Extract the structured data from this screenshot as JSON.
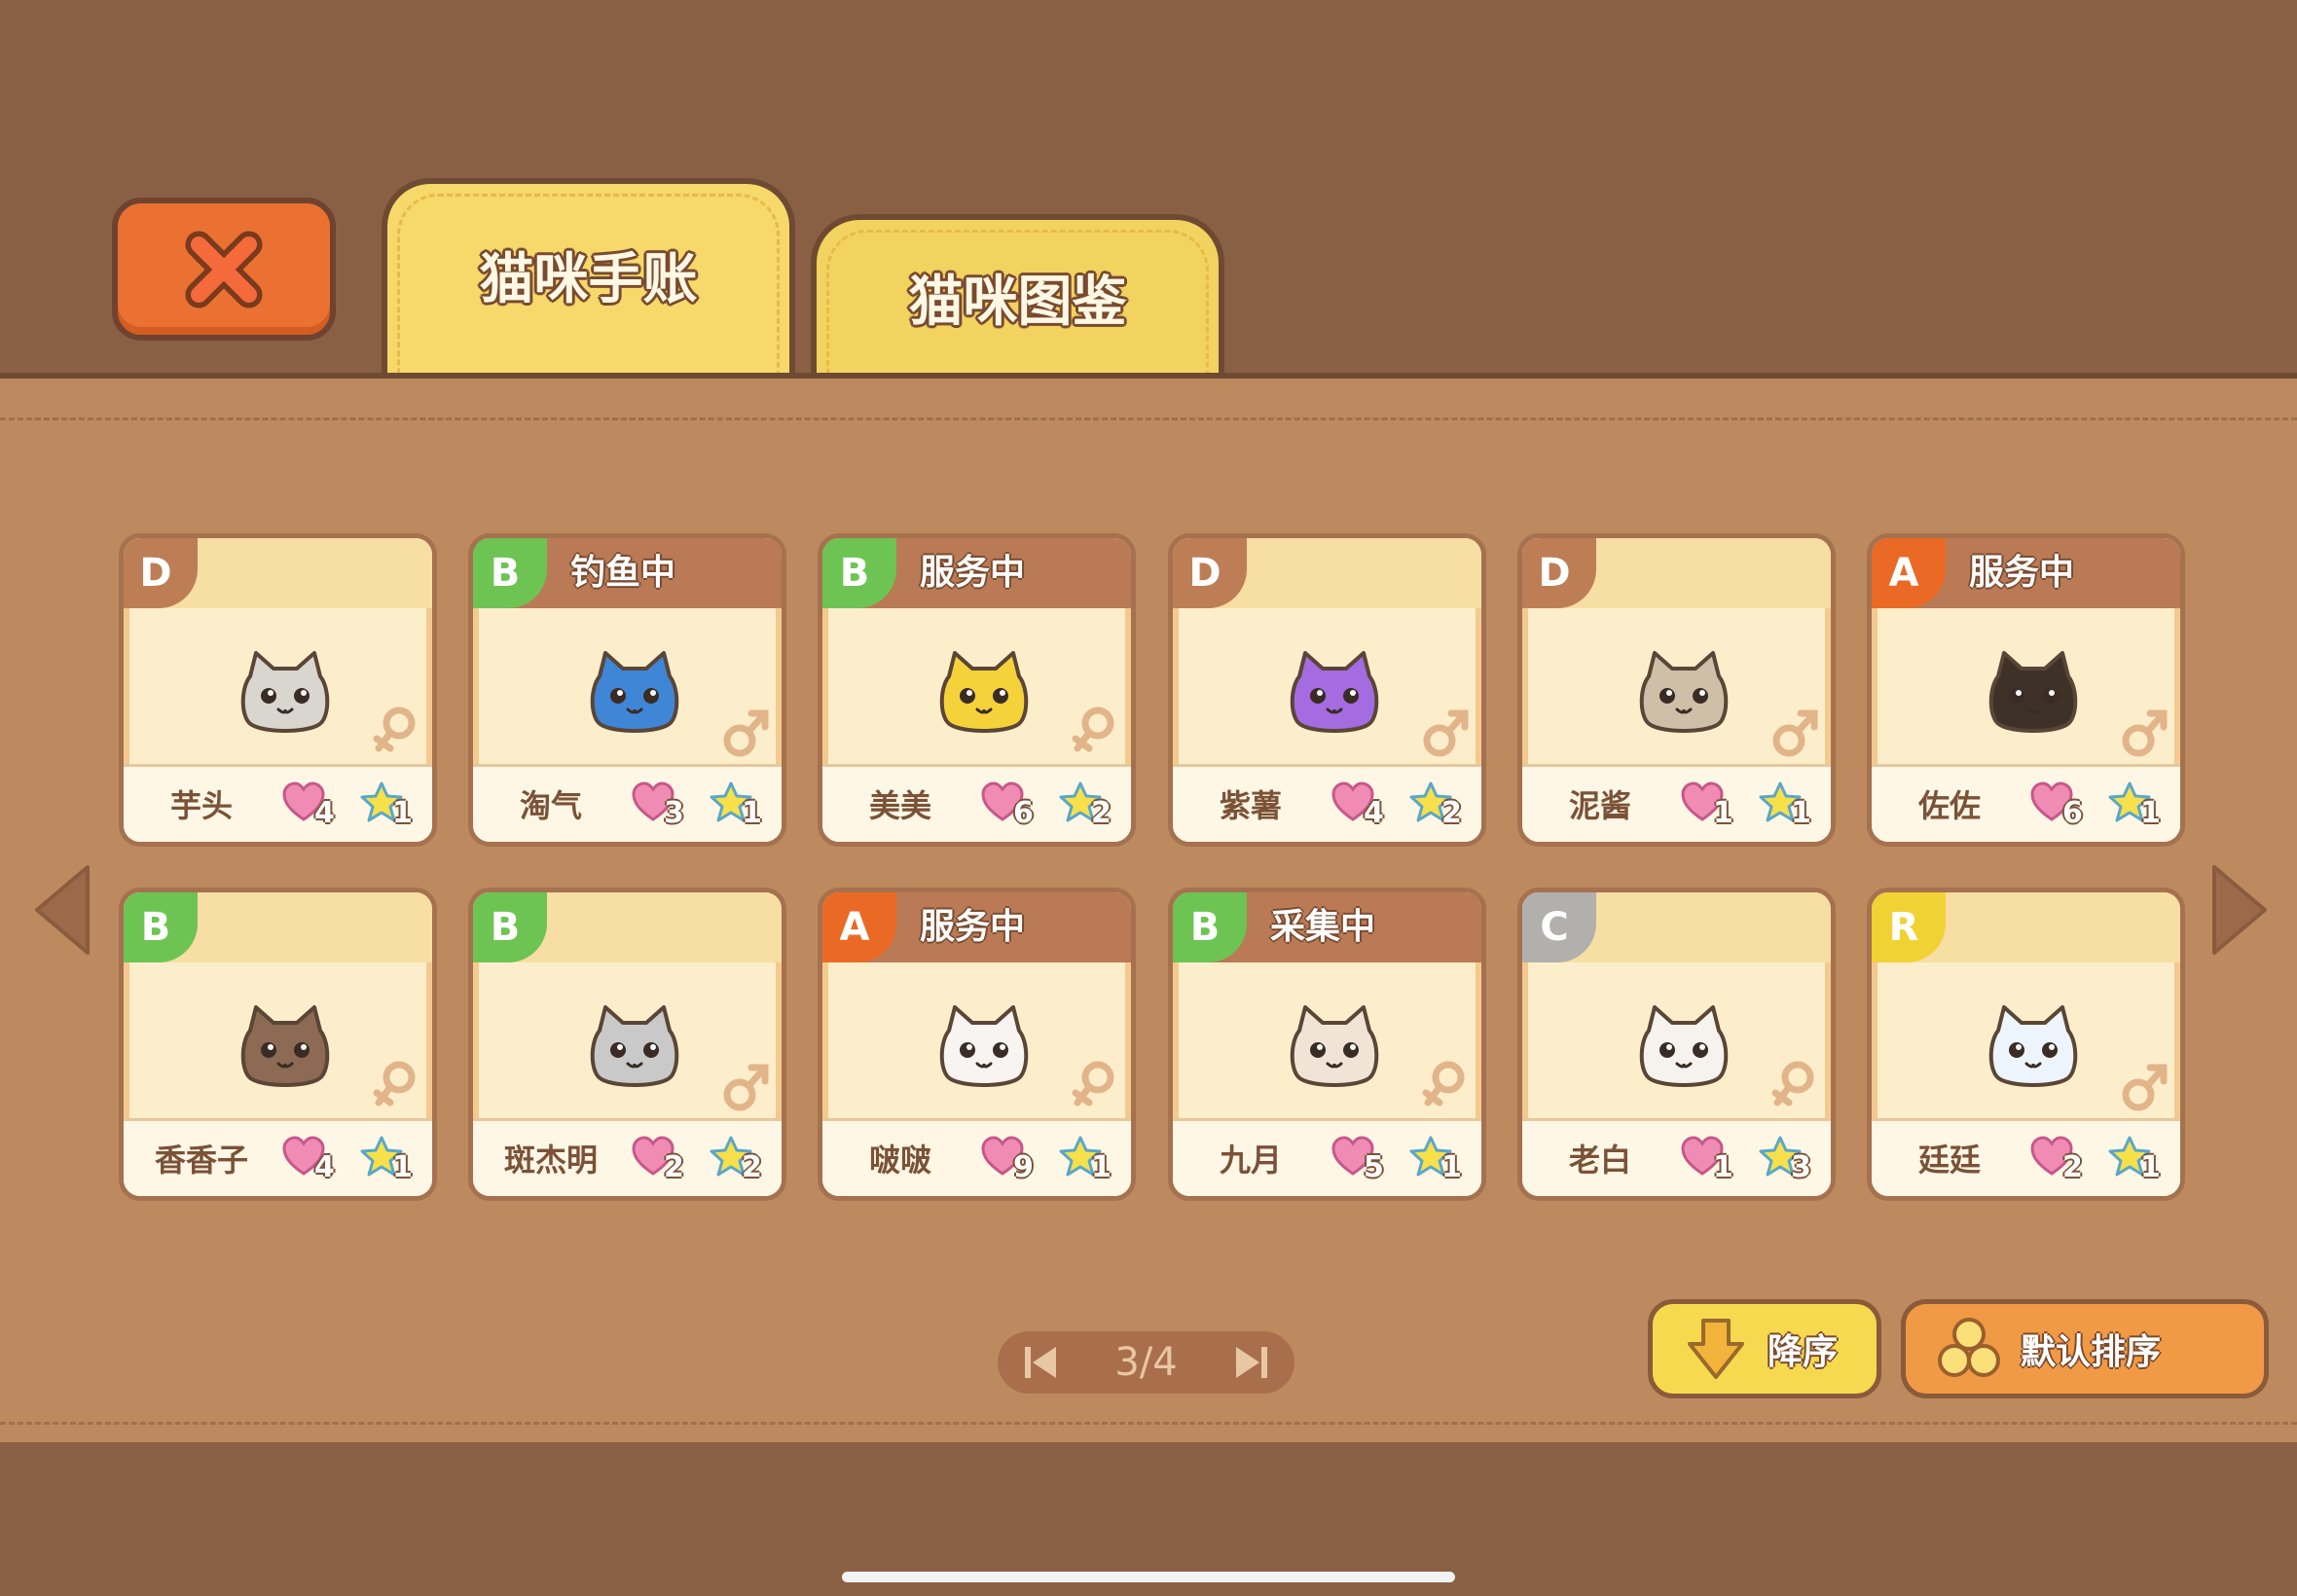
{
  "tabs": [
    {
      "label": "猫咪手账"
    },
    {
      "label": "猫咪图鉴"
    }
  ],
  "cats": [
    {
      "grade": "D",
      "status": "",
      "name": "芋头",
      "hearts": "4",
      "stars": "1",
      "gender": "female",
      "color": "#d9d5cf"
    },
    {
      "grade": "B",
      "status": "钓鱼中",
      "name": "淘气",
      "hearts": "3",
      "stars": "1",
      "gender": "male",
      "color": "#3f86d6"
    },
    {
      "grade": "B",
      "status": "服务中",
      "name": "美美",
      "hearts": "6",
      "stars": "2",
      "gender": "female",
      "color": "#f5d23a"
    },
    {
      "grade": "D",
      "status": "",
      "name": "紫薯",
      "hearts": "4",
      "stars": "2",
      "gender": "male",
      "color": "#a56be0"
    },
    {
      "grade": "D",
      "status": "",
      "name": "泥酱",
      "hearts": "1",
      "stars": "1",
      "gender": "male",
      "color": "#cdbfa8"
    },
    {
      "grade": "A",
      "status": "服务中",
      "name": "佐佐",
      "hearts": "6",
      "stars": "1",
      "gender": "male",
      "color": "#3d3128"
    },
    {
      "grade": "B",
      "status": "",
      "name": "香香子",
      "hearts": "4",
      "stars": "1",
      "gender": "female",
      "color": "#8c6a53"
    },
    {
      "grade": "B",
      "status": "",
      "name": "斑杰明",
      "hearts": "2",
      "stars": "2",
      "gender": "male",
      "color": "#c9c9c9"
    },
    {
      "grade": "A",
      "status": "服务中",
      "name": "啵啵",
      "hearts": "9",
      "stars": "1",
      "gender": "female",
      "color": "#f7f4f2"
    },
    {
      "grade": "B",
      "status": "采集中",
      "name": "九月",
      "hearts": "5",
      "stars": "1",
      "gender": "female",
      "color": "#f1e4d6"
    },
    {
      "grade": "C",
      "status": "",
      "name": "老白",
      "hearts": "1",
      "stars": "3",
      "gender": "female",
      "color": "#f6f3ee"
    },
    {
      "grade": "R",
      "status": "",
      "name": "廷廷",
      "hearts": "2",
      "stars": "1",
      "gender": "male",
      "color": "#eef4fb"
    }
  ],
  "pager": {
    "text": "3/4"
  },
  "sort": {
    "descending_label": "降序",
    "default_label": "默认排序"
  },
  "colors": {
    "background": "#8a6044",
    "panel": "#bd8a5f",
    "tab": "#f6d96a",
    "close": "#ea7131",
    "female": "#e2b48a",
    "male": "#e2b48a"
  },
  "icons": [
    "close-icon",
    "arrow-left-icon",
    "arrow-right-icon",
    "heart-icon",
    "star-icon",
    "female-icon",
    "male-icon",
    "first-page-icon",
    "last-page-icon",
    "down-arrow-icon",
    "coins-icon"
  ]
}
